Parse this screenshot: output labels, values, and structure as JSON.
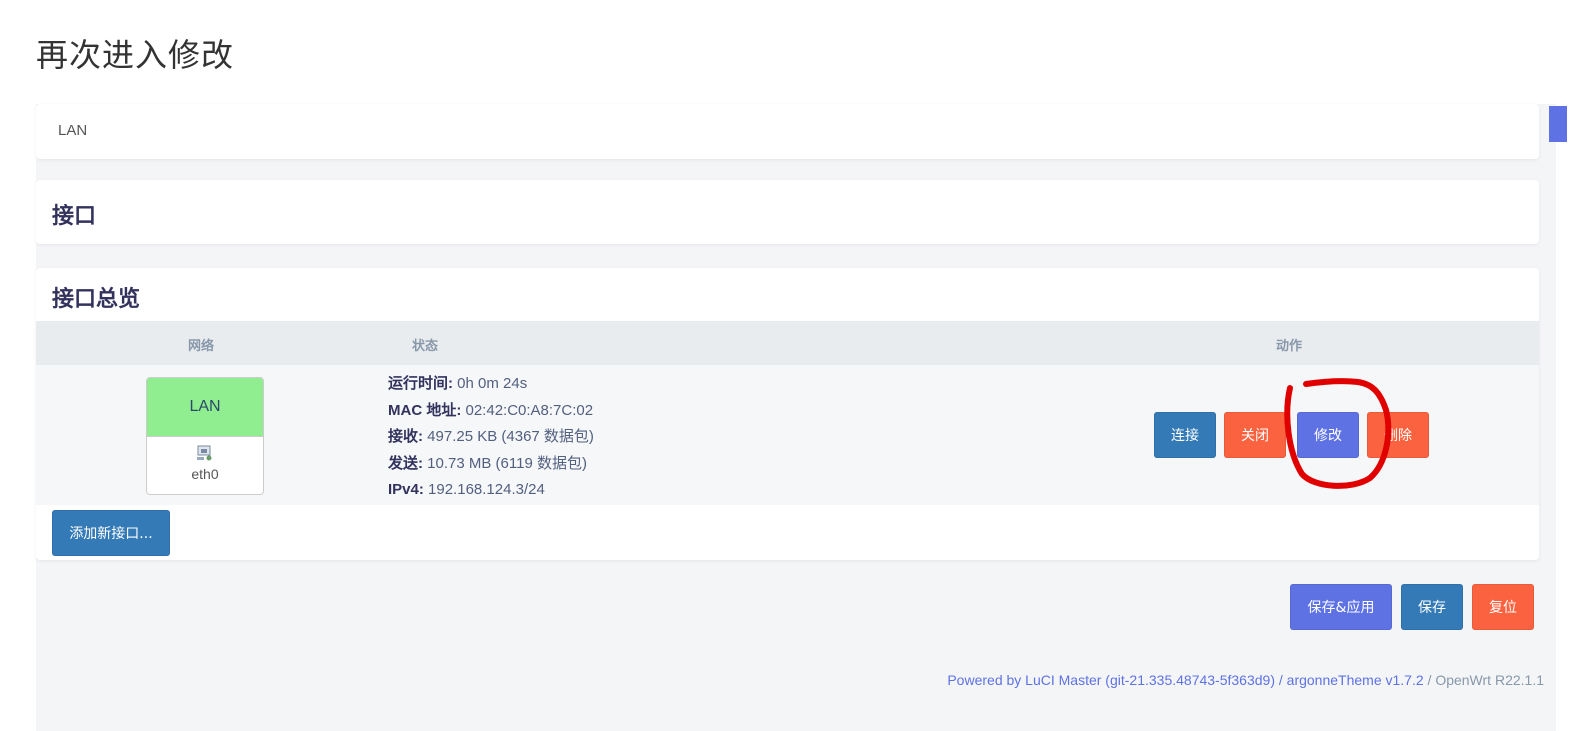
{
  "page": {
    "heading": "再次进入修改"
  },
  "tabs": [
    {
      "label": "LAN"
    }
  ],
  "section_interface": {
    "title": "接口"
  },
  "overview": {
    "title": "接口总览",
    "columns": [
      "网络",
      "状态",
      "动作"
    ],
    "rows": [
      {
        "network": {
          "name": "LAN",
          "device": "eth0",
          "color": "#90ee90",
          "icon": "ethernet-port-icon"
        },
        "status": {
          "uptime_label": "运行时间:",
          "uptime_value": "0h 0m 24s",
          "mac_label": "MAC 地址:",
          "mac_value": "02:42:C0:A8:7C:02",
          "rx_label": "接收:",
          "rx_value": "497.25 KB (4367 数据包)",
          "tx_label": "发送:",
          "tx_value": "10.73 MB (6119 数据包)",
          "ipv4_label": "IPv4:",
          "ipv4_value": "192.168.124.3/24"
        },
        "actions": {
          "connect": "连接",
          "stop": "关闭",
          "edit": "修改",
          "delete": "删除"
        }
      }
    ],
    "add_button": "添加新接口..."
  },
  "footer_actions": {
    "save_apply": "保存&应用",
    "save": "保存",
    "reset": "复位"
  },
  "footer": {
    "powered": "Powered by LuCI Master (git-21.335.48743-5f363d9)",
    "sep": " / ",
    "theme": "argonneTheme v1.7.2",
    "sep2": " / ",
    "os": "OpenWrt R22.1.1"
  },
  "colors": {
    "primary": "#5e72e4",
    "blue": "#337ab7",
    "orange": "#fb6340",
    "annotation": "#e00000"
  }
}
